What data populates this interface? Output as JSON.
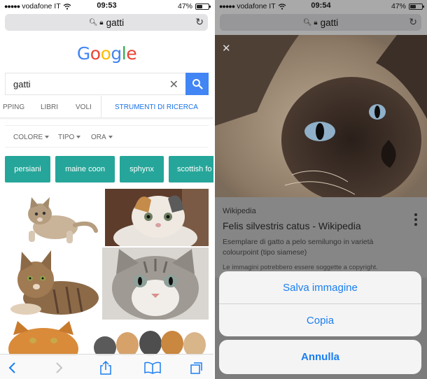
{
  "left_screen": {
    "status": {
      "carrier": "vodafone IT",
      "time": "09:53",
      "battery": "47%",
      "battery_level": 0.47
    },
    "url": "gatti",
    "google": {
      "logo": [
        "G",
        "o",
        "o",
        "g",
        "l",
        "e"
      ],
      "logo_colors": [
        "#4285f4",
        "#ea4335",
        "#fbbc05",
        "#4285f4",
        "#34a853",
        "#ea4335"
      ],
      "query": "gatti",
      "tabs": [
        "PPING",
        "LIBRI",
        "VOLI",
        "STRUMENTI DI RICERCA"
      ],
      "filters": [
        "COLORE",
        "TIPO",
        "ORA"
      ],
      "chips": [
        "persiani",
        "maine coon",
        "sphynx",
        "scottish fo"
      ],
      "accent": "#26a69a"
    },
    "toolbar_icons": [
      "back-icon",
      "forward-icon",
      "share-icon",
      "bookmarks-icon",
      "tabs-icon"
    ]
  },
  "right_screen": {
    "status": {
      "carrier": "vodafone IT",
      "time": "09:54",
      "battery": "47%",
      "battery_level": 0.47
    },
    "url": "gatti",
    "result": {
      "source": "Wikipedia",
      "title": "Felis silvestris catus - Wikipedia",
      "description": "Esemplare di gatto a pelo semilungo in varietà colourpoint (tipo siamese)",
      "note": "Le immagini potrebbero essere soggette a copyright."
    },
    "action_sheet": {
      "save": "Salva immagine",
      "copy": "Copia",
      "cancel": "Annulla",
      "accent": "#1a7ef0"
    }
  }
}
